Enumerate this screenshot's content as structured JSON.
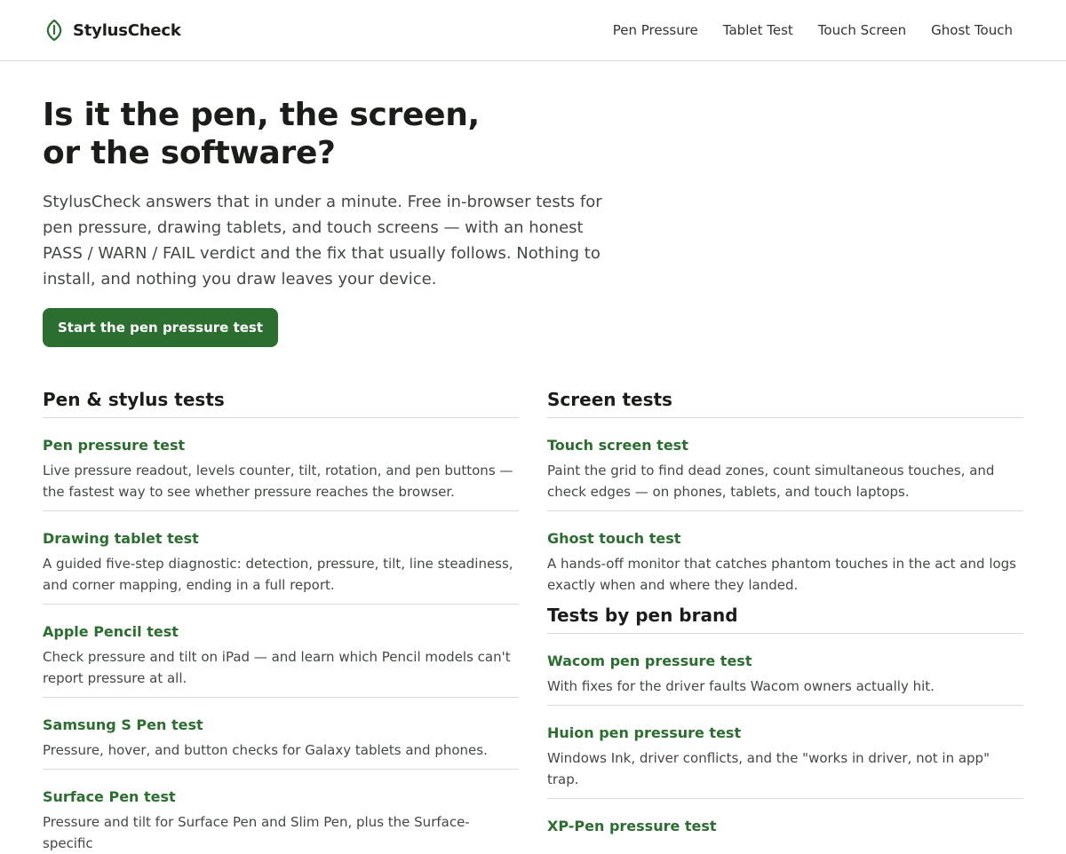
{
  "header": {
    "brand": "StylusCheck",
    "nav": [
      {
        "label": "Pen Pressure"
      },
      {
        "label": "Tablet Test"
      },
      {
        "label": "Touch Screen"
      },
      {
        "label": "Ghost Touch"
      }
    ]
  },
  "hero": {
    "title_line1": "Is it the pen, the screen,",
    "title_line2": "or the software?",
    "lede": "StylusCheck answers that in under a minute. Free in-browser tests for pen pressure, drawing tablets, and touch screens — with an honest PASS / WARN / FAIL verdict and the fix that usually follows. Nothing to install, and nothing you draw leaves your device.",
    "cta_label": "Start the pen pressure test"
  },
  "pen_tests": {
    "title": "Pen & stylus tests",
    "items": [
      {
        "title": "Pen pressure test",
        "desc": "Live pressure readout, levels counter, tilt, rotation, and pen buttons — the fastest way to see whether pressure reaches the browser."
      },
      {
        "title": "Drawing tablet test",
        "desc": "A guided five-step diagnostic: detection, pressure, tilt, line steadiness, and corner mapping, ending in a full report."
      },
      {
        "title": "Apple Pencil test",
        "desc": "Check pressure and tilt on iPad — and learn which Pencil models can't report pressure at all."
      },
      {
        "title": "Samsung S Pen test",
        "desc": "Pressure, hover, and button checks for Galaxy tablets and phones."
      },
      {
        "title": "Surface Pen test",
        "desc": "Pressure and tilt for Surface Pen and Slim Pen, plus the Surface-specific"
      }
    ]
  },
  "screen_tests": {
    "title": "Screen tests",
    "items": [
      {
        "title": "Touch screen test",
        "desc": "Paint the grid to find dead zones, count simultaneous touches, and check edges — on phones, tablets, and touch laptops."
      },
      {
        "title": "Ghost touch test",
        "desc": "A hands-off monitor that catches phantom touches in the act and logs exactly when and where they landed."
      }
    ]
  },
  "brand_tests": {
    "title": "Tests by pen brand",
    "items": [
      {
        "title": "Wacom pen pressure test",
        "desc": "With fixes for the driver faults Wacom owners actually hit."
      },
      {
        "title": "Huion pen pressure test",
        "desc": "Windows Ink, driver conflicts, and the \"works in driver, not in app\" trap."
      },
      {
        "title": "XP-Pen pressure test",
        "desc": ""
      }
    ]
  },
  "colors": {
    "accent": "#2b6e30",
    "text": "#1c1f1c",
    "muted": "#444844",
    "divider": "#d9d9d9"
  },
  "icons": {
    "brand_logo": "pen-nib-icon"
  }
}
